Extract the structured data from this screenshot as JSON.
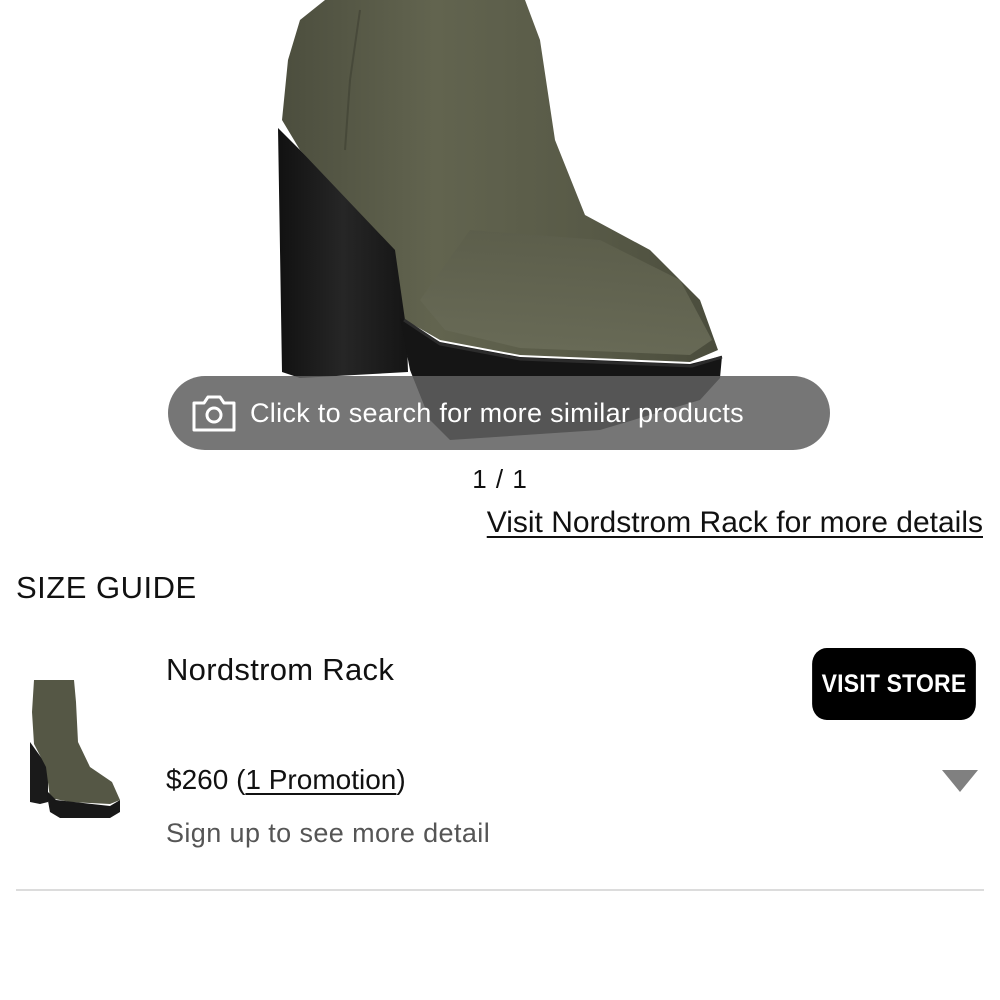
{
  "gallery": {
    "visual_search_label": "Click to search for more similar products",
    "counter": "1 / 1"
  },
  "visit_link": "Visit Nordstrom Rack for more details",
  "size_guide": "SIZE GUIDE",
  "store": {
    "name": "Nordstrom Rack",
    "visit_button": "VISIT STORE",
    "price": "$260",
    "promo_open": "(",
    "promo_label": "1 Promotion",
    "promo_close": ")",
    "signup": "Sign up to see more detail"
  },
  "icons": {
    "camera": "camera-icon",
    "expand": "triangle-down-icon"
  },
  "colors": {
    "boot": "#5a5c4a",
    "heel": "#1c1c1c",
    "button": "#000000",
    "pill": "#5f5f5f"
  }
}
